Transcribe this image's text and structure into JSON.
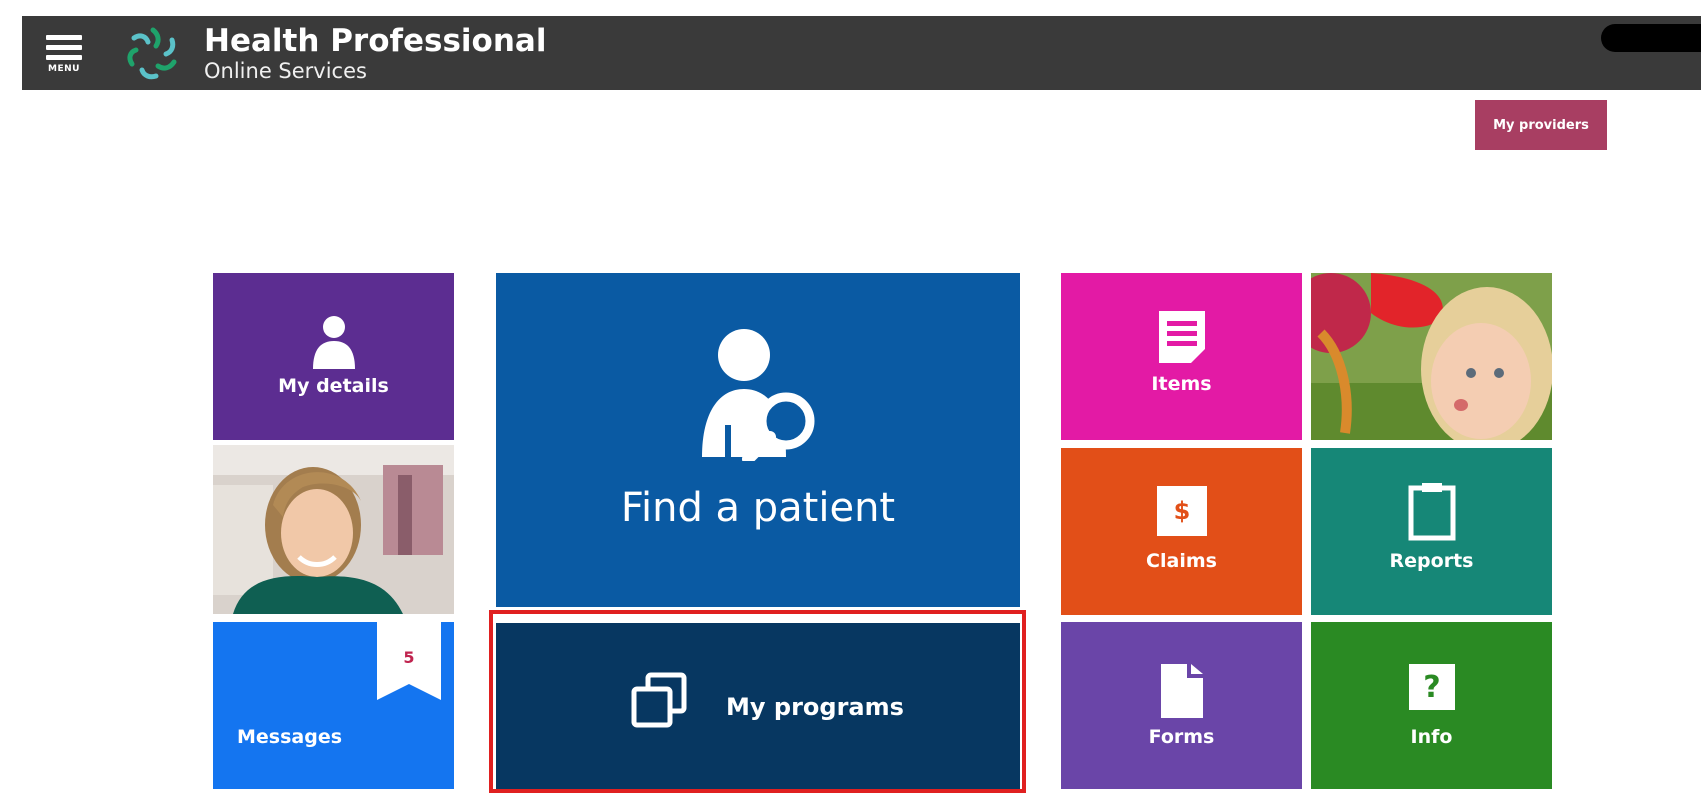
{
  "header": {
    "menu_label": "MENU",
    "title_line1": "Health Professional",
    "title_line2": "Online Services"
  },
  "my_providers_label": "My providers",
  "tiles": {
    "my_details": "My details",
    "messages": "Messages",
    "messages_count": "5",
    "find_patient": "Find a patient",
    "my_programs": "My programs",
    "items": "Items",
    "claims": "Claims",
    "reports": "Reports",
    "forms": "Forms",
    "info": "Info"
  },
  "colors": {
    "header_bg": "#3a3a3a",
    "my_providers": "#a83e62",
    "my_details": "#5c2d91",
    "messages": "#1475f0",
    "find_patient": "#0a5aa3",
    "my_programs": "#073761",
    "items": "#e31aa5",
    "claims": "#e24f18",
    "reports": "#168777",
    "forms": "#6a45a8",
    "info": "#2a8a23",
    "selection_outline": "#e02020"
  },
  "icons": {
    "menu": "hamburger-icon",
    "logo": "star-logo",
    "my_details": "person-icon",
    "find_patient": "person-search-icon",
    "my_programs": "copy-windows-icon",
    "items": "document-list-icon",
    "claims": "dollar-icon",
    "reports": "clipboard-icon",
    "forms": "file-icon",
    "info": "question-icon"
  }
}
